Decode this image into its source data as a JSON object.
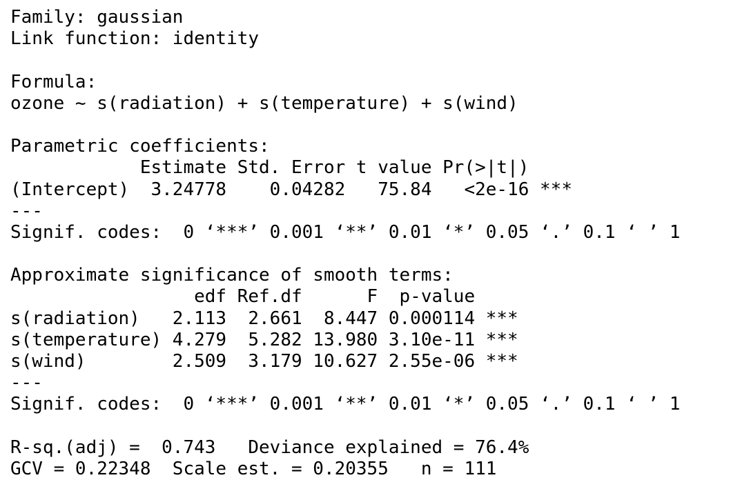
{
  "output": {
    "lines": [
      "Family: gaussian",
      "Link function: identity",
      "",
      "Formula:",
      "ozone ~ s(radiation) + s(temperature) + s(wind)",
      "",
      "Parametric coefficients:",
      "            Estimate Std. Error t value Pr(>|t|)    ",
      "(Intercept)  3.24778    0.04282   75.84   <2e-16 ***",
      "---",
      "Signif. codes:  0 ‘***’ 0.001 ‘**’ 0.01 ‘*’ 0.05 ‘.’ 0.1 ‘ ’ 1",
      "",
      "Approximate significance of smooth terms:",
      "                 edf Ref.df      F  p-value    ",
      "s(radiation)   2.113  2.661  8.447 0.000114 ***",
      "s(temperature) 4.279  5.282 13.980 3.10e-11 ***",
      "s(wind)        2.509  3.179 10.627 2.55e-06 ***",
      "---",
      "Signif. codes:  0 ‘***’ 0.001 ‘**’ 0.01 ‘*’ 0.05 ‘.’ 0.1 ‘ ’ 1",
      "",
      "R-sq.(adj) =  0.743   Deviance explained = 76.4%",
      "GCV = 0.22348  Scale est. = 0.20355   n = 111"
    ]
  }
}
